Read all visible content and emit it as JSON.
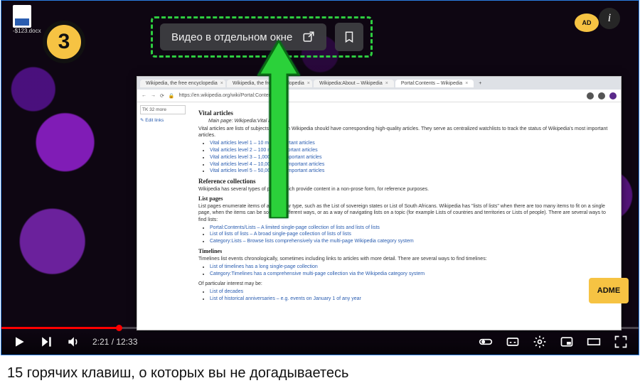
{
  "desktop": {
    "filename": "-$123.docx"
  },
  "badge_number": "3",
  "info_glyph": "i",
  "ad_label": "AD",
  "popup": {
    "label": "Видео в отдельном окне"
  },
  "browser": {
    "tabs": [
      {
        "label": "Wikipedia, the free encyclopedia"
      },
      {
        "label": "Wikipedia, the free encyclopedia"
      },
      {
        "label": "Wikipedia:About – Wikipedia"
      },
      {
        "label": "Portal:Contents – Wikipedia"
      }
    ],
    "plus": "+",
    "url": "https://en.wikipedia.org/wiki/Portal:Contents",
    "lock": "🔒",
    "sidebar": {
      "tk_more": "TK 32 more",
      "edit_links": "✎ Edit links"
    },
    "content": {
      "h_vital": "Vital articles",
      "vital_main": "Main page: Wikipedia:Vital articles",
      "vital_p": "Vital articles are lists of subjects for which Wikipedia should have corresponding high-quality articles. They serve as centralized watchlists to track the status of Wikipedia's most important articles.",
      "vital_items": [
        "Vital articles level 1 – 10 most important articles",
        "Vital articles level 2 – 100 most important articles",
        "Vital articles level 3 – 1,000 most important articles",
        "Vital articles level 4 – 10,000 most important articles",
        "Vital articles level 5 – 50,000 most important articles"
      ],
      "h_ref": "Reference collections",
      "ref_p": "Wikipedia has several types of pages which provide content in a non-prose form, for reference purposes.",
      "h_list": "List pages",
      "list_p": "List pages enumerate items of a particular type, such as the List of sovereign states or List of South Africans. Wikipedia has \"lists of lists\" when there are too many items to fit on a single page, when the items can be sorted in different ways, or as a way of navigating lists on a topic (for example Lists of countries and territories or Lists of people). There are several ways to find lists:",
      "list_items": [
        "Portal:Contents/Lists – A limited single-page collection of lists and lists of lists",
        "List of lists of lists – A broad single-page collection of lists of lists",
        "Category:Lists – Browse lists comprehensively via the multi-page Wikipedia category system"
      ],
      "h_time": "Timelines",
      "time_p": "Timelines list events chronologically, sometimes including links to articles with more detail. There are several ways to find timelines:",
      "time_items": [
        "List of timelines has a long single-page collection",
        "Category:Timelines has a comprehensive multi-page collection via the Wikipedia category system"
      ],
      "of_interest": "Of particular interest may be:",
      "extra_items": [
        "List of decades",
        "List of historical anniversaries – e.g. events on January 1 of any year"
      ]
    }
  },
  "adme": "ADME",
  "player": {
    "current": "2:21",
    "sep": " / ",
    "duration": "12:33"
  },
  "caption": "15 горячих клавиш, о которых вы не догадываетесь"
}
